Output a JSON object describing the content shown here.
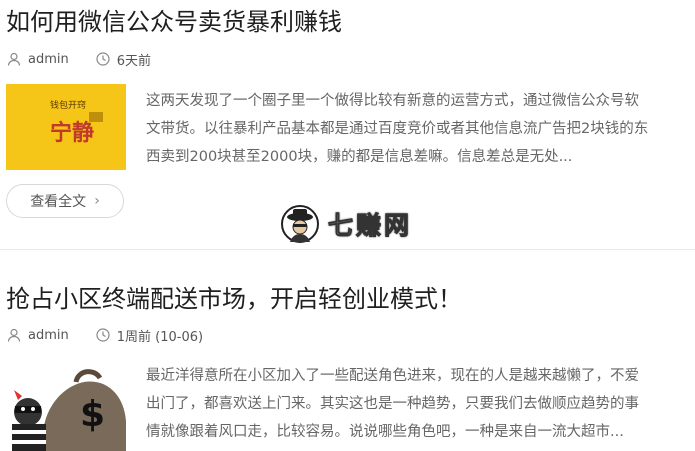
{
  "posts": [
    {
      "title": "如何用微信公众号卖货暴利赚钱",
      "author": "admin",
      "time": "6天前",
      "thumb_text": [
        "钱包开窍",
        "宁静"
      ],
      "excerpt": [
        "这两天发现了一个圈子里一个做得比较有新意的运营方式，通过微信公众号软",
        "文带货。以往暴利产品基本都是通过百度竞价或者其他信息流广告把2块钱的东",
        "西卖到200块甚至2000块，赚的都是信息差嘛。信息差总是无处..."
      ],
      "read_more": "查看全文"
    },
    {
      "title": "抢占小区终端配送市场，开启轻创业模式！",
      "author": "admin",
      "time": "1周前 (10-06)",
      "excerpt": [
        "最近洋得意所在小区加入了一些配送角色进来，现在的人是越来越懒了，不爱",
        "出门了，都喜欢送上门来。其实这也是一种趋势，只要我们去做顺应趋势的事",
        "情就像跟着风口走，比较容易。说说哪些角色吧，一种是来自一流大超市..."
      ]
    }
  ],
  "watermark": "七赚网",
  "colors": {
    "thumb1_bg": "#f5c518",
    "thumb1_text": "#5a3a00",
    "thumb1_accent": "#c0392b",
    "divider": "#e9e9e9"
  }
}
